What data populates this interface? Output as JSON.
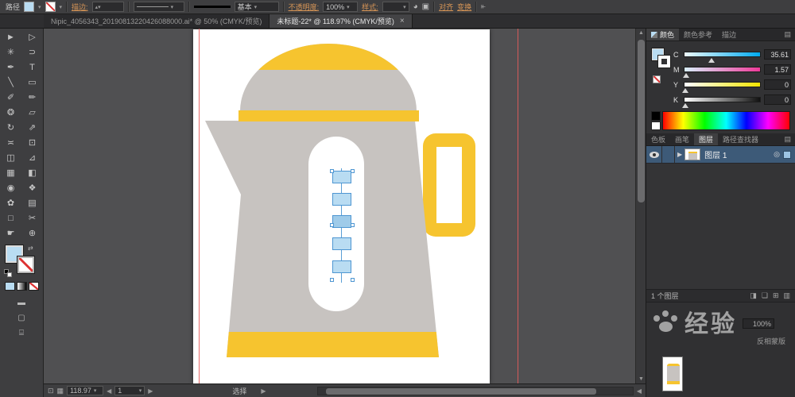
{
  "topbar": {
    "path_label": "路径",
    "stroke_link": "描边:",
    "brush_label": "基本",
    "opacity_link": "不透明度:",
    "opacity_value": "100%",
    "style_link": "样式:",
    "align_link": "对齐",
    "transform_link": "变换"
  },
  "tabs": {
    "inactive": "Nipic_4056343_20190813220426088000.ai* @ 50% (CMYK/预览)",
    "active": "未标题-22* @ 118.97% (CMYK/预览)",
    "close": "×"
  },
  "toolbar": {
    "tools": [
      {
        "name": "selection",
        "glyph": "►"
      },
      {
        "name": "direct-selection",
        "glyph": "▷"
      },
      {
        "name": "magic-wand",
        "glyph": "✳"
      },
      {
        "name": "lasso",
        "glyph": "⊃"
      },
      {
        "name": "pen",
        "glyph": "✒"
      },
      {
        "name": "type",
        "glyph": "T"
      },
      {
        "name": "line",
        "glyph": "╲"
      },
      {
        "name": "rectangle",
        "glyph": "▭"
      },
      {
        "name": "paintbrush",
        "glyph": "✐"
      },
      {
        "name": "pencil",
        "glyph": "✏"
      },
      {
        "name": "blob-brush",
        "glyph": "❂"
      },
      {
        "name": "eraser",
        "glyph": "▱"
      },
      {
        "name": "rotate",
        "glyph": "↻"
      },
      {
        "name": "scale",
        "glyph": "⇗"
      },
      {
        "name": "width",
        "glyph": "≍"
      },
      {
        "name": "free-transform",
        "glyph": "⊡"
      },
      {
        "name": "shape-builder",
        "glyph": "◫"
      },
      {
        "name": "perspective-grid",
        "glyph": "⊿"
      },
      {
        "name": "mesh",
        "glyph": "▦"
      },
      {
        "name": "gradient",
        "glyph": "◧"
      },
      {
        "name": "eyedropper",
        "glyph": "◉"
      },
      {
        "name": "blend",
        "glyph": "❖"
      },
      {
        "name": "symbol-sprayer",
        "glyph": "✿"
      },
      {
        "name": "column-graph",
        "glyph": "▤"
      },
      {
        "name": "artboard",
        "glyph": "□"
      },
      {
        "name": "slice",
        "glyph": "✂"
      },
      {
        "name": "hand",
        "glyph": "☛"
      },
      {
        "name": "zoom",
        "glyph": "⊕"
      }
    ]
  },
  "color_panel": {
    "tabs": [
      "颜色",
      "颜色参考",
      "描边"
    ],
    "sliders": [
      {
        "channel": "C",
        "value": "35.61"
      },
      {
        "channel": "M",
        "value": "1.57"
      },
      {
        "channel": "Y",
        "value": "0"
      },
      {
        "channel": "K",
        "value": "0"
      }
    ]
  },
  "panel_tabs": [
    "色板",
    "画笔",
    "图层",
    "路径查找器"
  ],
  "layers_panel": {
    "layer_name": "图层 1",
    "status": "1 个图层"
  },
  "transparency_panel": {
    "opacity": "100%",
    "invert_label": "反相蒙版"
  },
  "statusbar": {
    "zoom": "118.97",
    "artboard": "1",
    "mode": "选择"
  },
  "watermark": {
    "text": "经验"
  },
  "colors": {
    "kettle_gray": "#C7C3C0",
    "kettle_yellow": "#F6C42F",
    "object_fill_blue": "#B9DCF2",
    "selection_blue": "#4E96D2",
    "link_orange": "#D79556",
    "layer_selected": "#3D5A78",
    "guide_red": "#E25B5B"
  }
}
